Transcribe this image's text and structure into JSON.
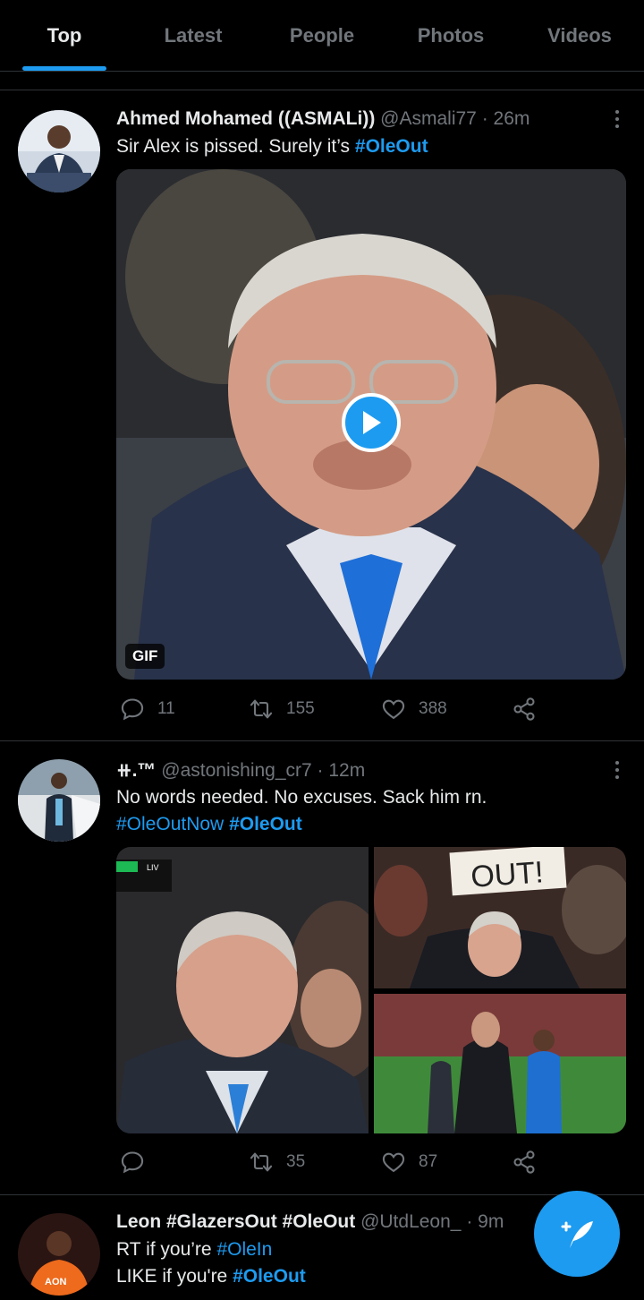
{
  "tabs": [
    {
      "label": "Top",
      "active": true
    },
    {
      "label": "Latest",
      "active": false
    },
    {
      "label": "People",
      "active": false
    },
    {
      "label": "Photos",
      "active": false
    },
    {
      "label": "Videos",
      "active": false
    }
  ],
  "colors": {
    "accent": "#1d9bf0",
    "background": "#000000",
    "muted": "#71767b",
    "divider": "#2f3336"
  },
  "tweets": [
    {
      "name": "Ahmed Mohamed ((ASMALi))",
      "handle": "@Asmali77",
      "sep": " · ",
      "time": "26m",
      "text_pre": "Sir Alex is pissed. Surely it’s ",
      "hashtag": "#OleOut",
      "media_badge": "GIF",
      "replies": "11",
      "retweets": "155",
      "likes": "388"
    },
    {
      "name": "⧺.™",
      "handle": "@astonishing_cr7",
      "sep": " · ",
      "time": "12m",
      "text_line1": "No words needed. No excuses. Sack him rn.",
      "hashtag1": "#OleOutNow",
      "hashtag2": "#OleOut",
      "sign_text": "OUT!",
      "score_text": "LIV",
      "retweets": "35",
      "likes": "87"
    },
    {
      "name": "Leon #GlazersOut #OleOut",
      "handle": "@UtdLeon_",
      "sep": " · ",
      "time": "9m",
      "line1_pre": "RT if you’re ",
      "line1_tag": "#OleIn",
      "line2_pre": "LIKE if you're ",
      "line2_tag": "#OleOut",
      "shirt_text": "AON"
    }
  ],
  "icons": [
    "reply-icon",
    "retweet-icon",
    "like-icon",
    "share-icon",
    "more-icon",
    "play-icon",
    "compose-icon"
  ]
}
